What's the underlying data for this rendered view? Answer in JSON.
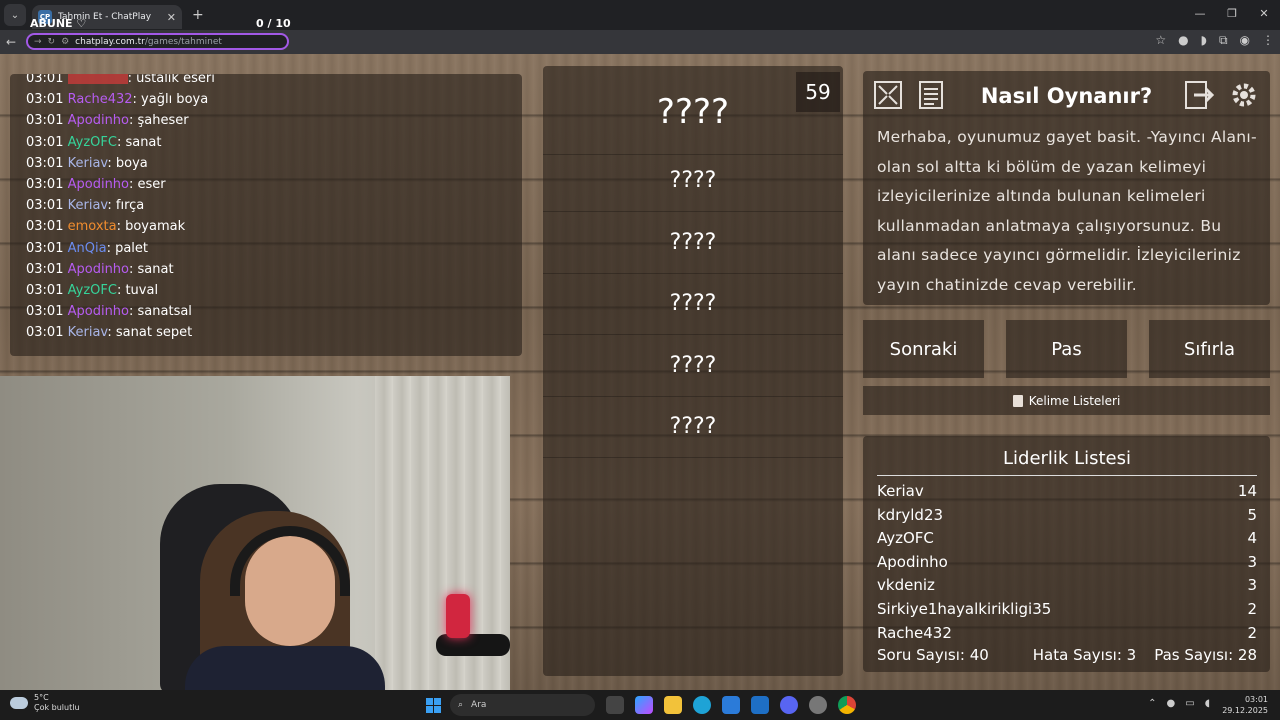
{
  "browser": {
    "tab_title": "Tahmin Et - ChatPlay",
    "favicon_text": "CP",
    "url_domain": "chatplay.com.tr",
    "url_path": "/games/tahminet",
    "overlay_label": "ABUNE ♡",
    "overlay_counter": "0 / 10"
  },
  "chat": {
    "messages": [
      {
        "time": "03:01",
        "user": "",
        "text": ": ustalık eseri",
        "color": "#d93b3b"
      },
      {
        "time": "03:01",
        "user": "Rache432",
        "text": ": yağlı boya",
        "color": "#b65cf0"
      },
      {
        "time": "03:01",
        "user": "Apodinho",
        "text": ": şaheser",
        "color": "#b65cf0"
      },
      {
        "time": "03:01",
        "user": "AyzOFC",
        "text": ": sanat",
        "color": "#36d39a"
      },
      {
        "time": "03:01",
        "user": "Keriav",
        "text": ": boya",
        "color": "#a9b6e8"
      },
      {
        "time": "03:01",
        "user": "Apodinho",
        "text": ": eser",
        "color": "#b65cf0"
      },
      {
        "time": "03:01",
        "user": "Keriav",
        "text": ": fırça",
        "color": "#a9b6e8"
      },
      {
        "time": "03:01",
        "user": "emoxta",
        "text": ": boyamak",
        "color": "#f08c2e"
      },
      {
        "time": "03:01",
        "user": "AnQia",
        "text": ": palet",
        "color": "#6b8cf0"
      },
      {
        "time": "03:01",
        "user": "Apodinho",
        "text": ": sanat",
        "color": "#b65cf0"
      },
      {
        "time": "03:01",
        "user": "AyzOFC",
        "text": ": tuval",
        "color": "#36d39a"
      },
      {
        "time": "03:01",
        "user": "Apodinho",
        "text": ": sanatsal",
        "color": "#b65cf0"
      },
      {
        "time": "03:01",
        "user": "Keriav",
        "text": ": sanat sepet",
        "color": "#a9b6e8"
      }
    ]
  },
  "game": {
    "timer": "59",
    "main_word": "????",
    "hidden_words": [
      "????",
      "????",
      "????",
      "????",
      "????"
    ]
  },
  "howto": {
    "title": "Nasıl Oynanır?",
    "text": "Merhaba, oyunumuz gayet basit. -Yayıncı Alanı- olan sol altta ki bölüm de yazan kelimeyi izleyicilerinize altında bulunan kelimeleri kullanmadan anlatmaya çalışıyorsunuz. Bu alanı sadece yayıncı görmelidir. İzleyicileriniz yayın chatinizde cevap verebilir.",
    "icons": {
      "fullscreen": "fullscreen-icon",
      "rules": "document-icon",
      "exit": "exit-icon",
      "settings": "gear-icon"
    }
  },
  "controls": {
    "next": "Sonraki",
    "pass": "Pas",
    "reset": "Sıfırla",
    "word_lists": "Kelime Listeleri"
  },
  "leaderboard": {
    "title": "Liderlik Listesi",
    "rows": [
      {
        "name": "Keriav",
        "score": "14"
      },
      {
        "name": "kdryld23",
        "score": "5"
      },
      {
        "name": "AyzOFC",
        "score": "4"
      },
      {
        "name": "Apodinho",
        "score": "3"
      },
      {
        "name": "vkdeniz",
        "score": "3"
      },
      {
        "name": "Sirkiye1hayalkirikligi35",
        "score": "2"
      },
      {
        "name": "Rache432",
        "score": "2"
      }
    ]
  },
  "stats": {
    "questions": "Soru Sayısı: 40",
    "errors": "Hata Sayısı: 3",
    "passes": "Pas Sayısı: 28"
  },
  "taskbar": {
    "temperature": "5°C",
    "weather": "Çok bulutlu",
    "search_placeholder": "Ara",
    "time": "03:01",
    "date": "29.12.2025"
  }
}
